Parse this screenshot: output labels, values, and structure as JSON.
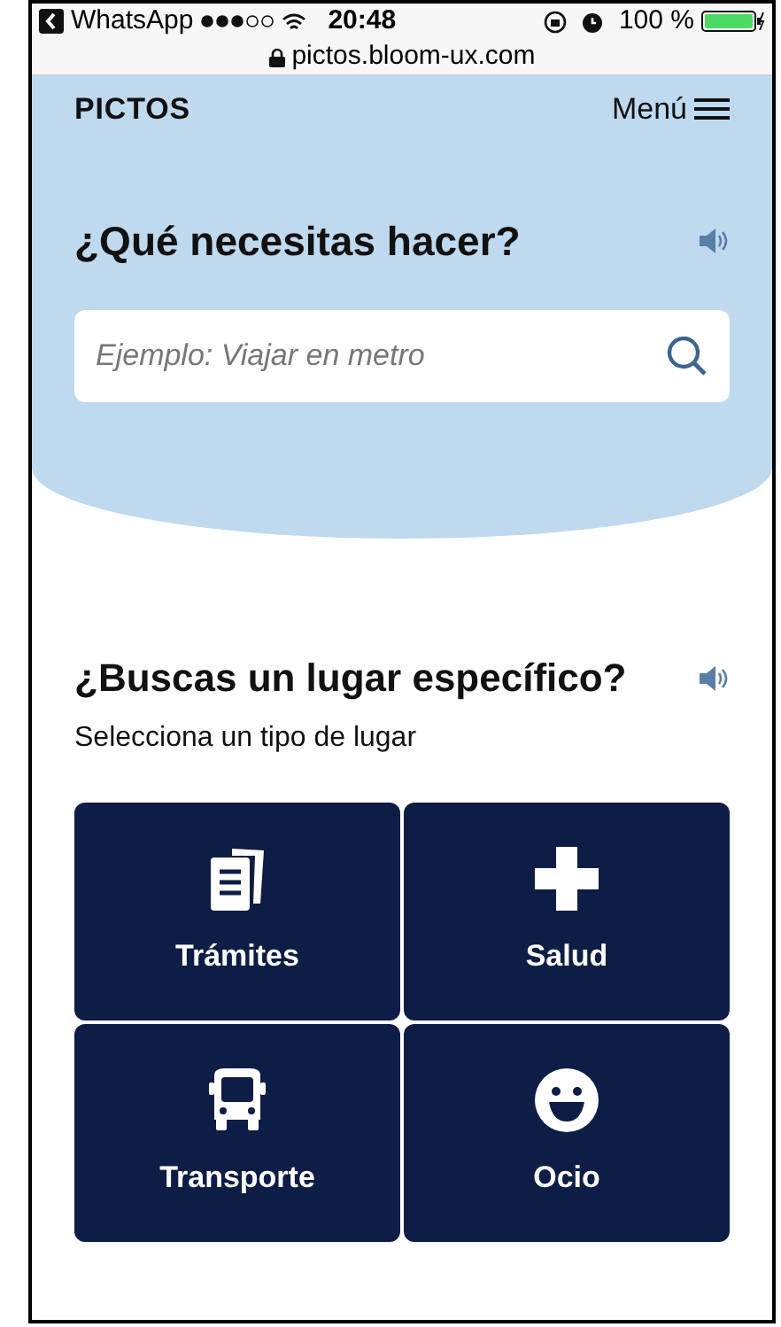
{
  "status_bar": {
    "back_app": "WhatsApp",
    "time": "20:48",
    "battery": "100 %"
  },
  "url_bar": {
    "url": "pictos.bloom-ux.com"
  },
  "header": {
    "logo": "PICTOS",
    "menu": "Menú"
  },
  "hero": {
    "title": "¿Qué necesitas hacer?",
    "search": {
      "placeholder": "Ejemplo: Viajar en metro"
    }
  },
  "places": {
    "title": "¿Buscas un lugar específico?",
    "subtitle": "Selecciona un tipo de lugar",
    "tiles": [
      {
        "label": "Trámites",
        "kind": "documents"
      },
      {
        "label": "Salud",
        "kind": "health"
      },
      {
        "label": "Transporte",
        "kind": "bus"
      },
      {
        "label": "Ocio",
        "kind": "smile"
      }
    ]
  }
}
